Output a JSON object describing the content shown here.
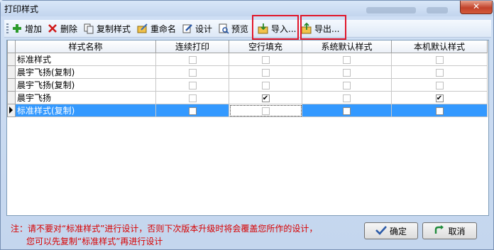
{
  "window": {
    "title": "打印样式",
    "close_glyph": "✕"
  },
  "toolbar": {
    "add": "增加",
    "delete": "删除",
    "copy": "复制样式",
    "rename": "重命名",
    "design": "设计",
    "preview": "预览",
    "import": "导入...",
    "export": "导出..."
  },
  "grid": {
    "columns": [
      "样式名称",
      "连续打印",
      "空行填充",
      "系统默认样式",
      "本机默认样式"
    ],
    "rows": [
      {
        "name": "标准样式",
        "continuous": false,
        "fill": false,
        "system_default": false,
        "local_default": false
      },
      {
        "name": "晨宇飞扬(复制)",
        "continuous": false,
        "fill": false,
        "system_default": false,
        "local_default": false
      },
      {
        "name": "晨宇飞扬(复制)",
        "continuous": false,
        "fill": false,
        "system_default": false,
        "local_default": false
      },
      {
        "name": "晨宇飞扬",
        "continuous": false,
        "fill": true,
        "system_default": false,
        "local_default": true
      },
      {
        "name": "标准样式(复制)",
        "continuous": false,
        "fill": false,
        "system_default": false,
        "local_default": false,
        "selected": true
      }
    ]
  },
  "note": {
    "line1": "注：请不要对“标准样式”进行设计，否则下次版本升级时将会覆盖您所作的设计，",
    "line2": "您可以先复制“标准样式”再进行设计"
  },
  "buttons": {
    "ok": "确定",
    "cancel": "取消"
  },
  "colors": {
    "highlight": "#e0162a",
    "selection": "#3399ff",
    "note": "#d80000"
  }
}
